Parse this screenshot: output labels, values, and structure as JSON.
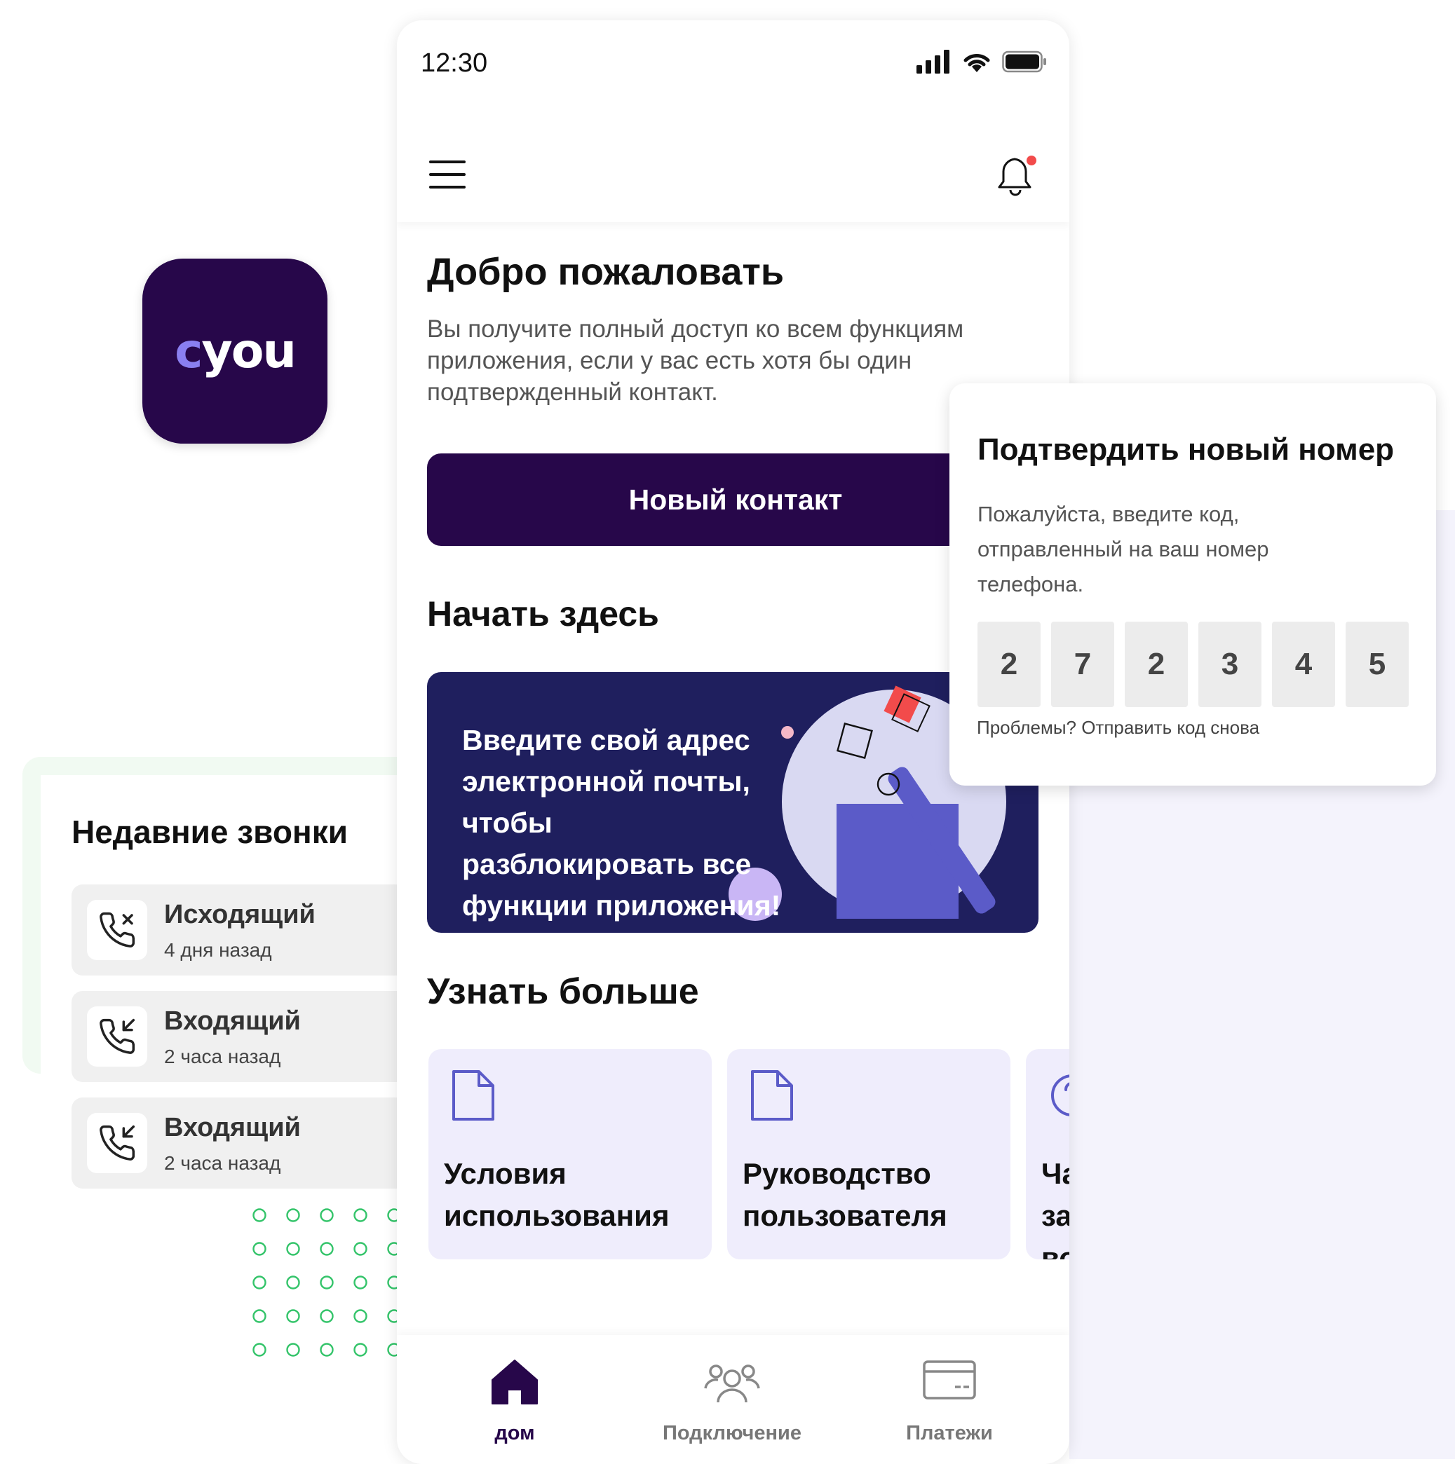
{
  "app_icon": {
    "logo_text_c": "c",
    "logo_text_rest": "you",
    "bg_color": "#27074a",
    "accent_color": "#8a7ff0"
  },
  "recent_calls": {
    "title": "Недавние звонки",
    "items": [
      {
        "type": "Исходящий",
        "time": "4 дня назад",
        "icon": "phone-missed-icon"
      },
      {
        "type": "Входящий",
        "time": "2 часа назад",
        "icon": "phone-incoming-icon"
      },
      {
        "type": "Входящий",
        "time": "2 часа назад",
        "icon": "phone-incoming-icon"
      }
    ]
  },
  "phone": {
    "status_time": "12:30",
    "welcome_title": "Добро пожаловать",
    "welcome_text": "Вы получите полный доступ ко всем функциям приложения, если у вас есть хотя бы один подтвержденный контакт.",
    "new_contact_label": "Новый контакт",
    "start_title": "Начать здесь",
    "banner_text": "Введите свой адрес электронной почты, чтобы разблокировать все функции приложения!",
    "learn_title": "Узнать больше",
    "learn_cards": [
      {
        "label": "Условия использования",
        "icon": "document-icon"
      },
      {
        "label": "Руководство пользователя",
        "icon": "document-icon"
      },
      {
        "label": "Часто задаваемые вопросы",
        "icon": "help-circle-icon"
      }
    ],
    "nav": [
      {
        "label": "дом",
        "icon": "home-icon",
        "active": true
      },
      {
        "label": "Подключение",
        "icon": "users-icon",
        "active": false
      },
      {
        "label": "Платежи",
        "icon": "card-icon",
        "active": false
      }
    ]
  },
  "verify": {
    "title": "Подтвердить новый номер",
    "text": "Пожалуйста, введите код, отправленный на ваш номер телефона.",
    "code": [
      "2",
      "7",
      "2",
      "3",
      "4",
      "5"
    ],
    "resend": "Проблемы? Отправить код снова"
  },
  "colors": {
    "primary": "#27074a",
    "banner": "#1f1f5e",
    "card_bg": "#efedfc",
    "notification_dot": "#f24b4b",
    "icon_accent": "#5b5bc8"
  }
}
